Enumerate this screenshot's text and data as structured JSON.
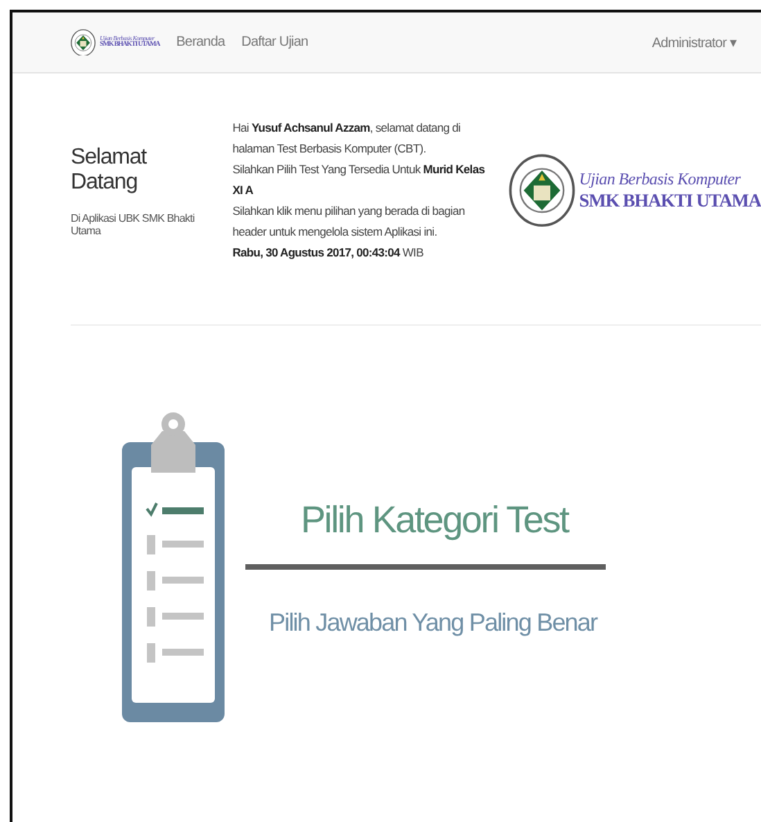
{
  "navbar": {
    "logo": {
      "line_1": "Ujian Berbasis Komputer",
      "line_2": "SMK BHAKTI UTAMA"
    },
    "links": [
      "Beranda",
      "Daftar Ujian"
    ],
    "user_menu": "Administrator ▾"
  },
  "welcome": {
    "title": "Selamat Datang",
    "subtitle": "Di Aplikasi UBK SMK Bhakti Utama",
    "paragraphs": [
      "Hai **Yusuf Achsanul Azzam**, selamat datang di halaman Test Berbasis Komputer (CBT).",
      "Silahkan Pilih Test Yang Tersedia Untuk **Murid Kelas XI A**",
      "Silahkan klik menu pilihan yang berada di bagian header untuk mengelola sistem Aplikasi ini.",
      "**Rabu, 30 Agustus 2017, 00:43:04** WIB"
    ],
    "logo": {
      "line_1": "Ujian Berbasis Komputer",
      "line_2": "SMK BHAKTI UTAMA"
    }
  },
  "banner": {
    "title": "Pilih Kategori Test",
    "subtitle": "Pilih Jawaban Yang Paling Benar"
  }
}
